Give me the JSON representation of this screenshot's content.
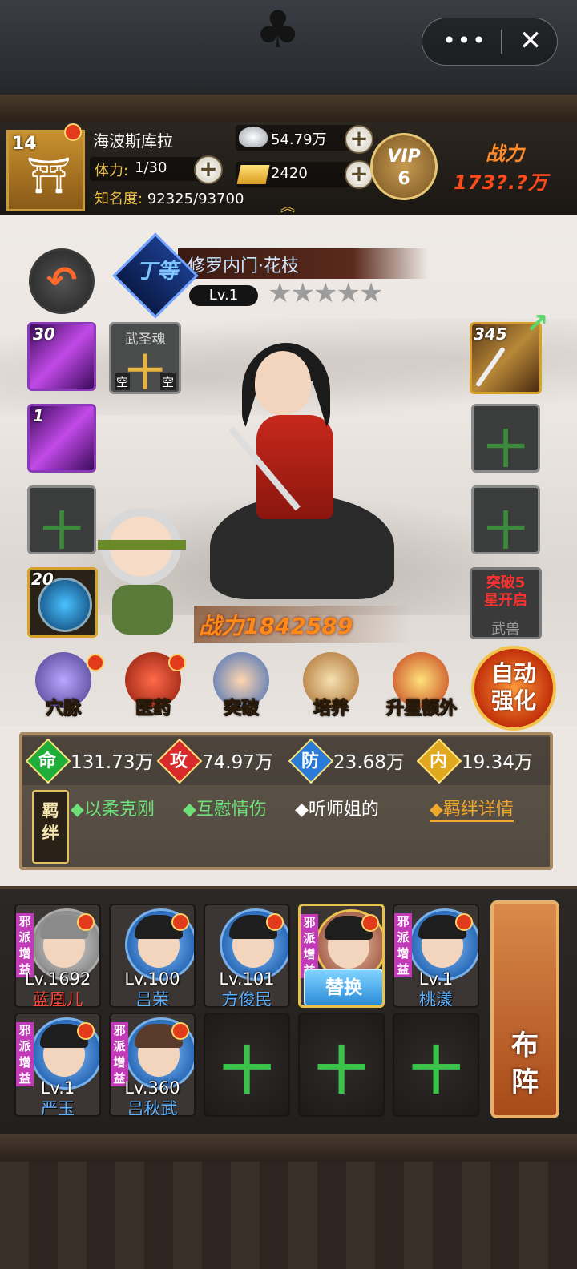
{
  "topbar": {
    "more_icon": "•••",
    "close_icon": "✕"
  },
  "player": {
    "level": "14",
    "name": "海波斯库拉",
    "stamina_label": "体力:",
    "stamina_value": "1/30",
    "fame_label": "知名度:",
    "fame_value": "92325/93700",
    "silver": "54.79万",
    "gold": "2420",
    "vip_label": "VIP",
    "vip_level": "6",
    "power_label": "战力",
    "power_value": "173?.?万"
  },
  "hero": {
    "grade": "丁等",
    "title": "修罗内门·花枝",
    "level": "Lv.1",
    "stars_total": 5,
    "stars_filled": 0,
    "stars": "★★★★★",
    "combat_power": "战力1842589"
  },
  "slots": {
    "skill1_level": "30",
    "skill2_level": "1",
    "soul_title": "武圣魂",
    "soul_plus": "十",
    "soul_empty_a": "空",
    "soul_empty_b": "空",
    "plus": "十",
    "weapon_level": "345",
    "orb_level": "20",
    "beast_lock": "突破5星开启",
    "beast_label": "武兽"
  },
  "actions": [
    {
      "label": "穴脉",
      "icon": "meridian-icon"
    },
    {
      "label": "医药",
      "icon": "medicine-icon"
    },
    {
      "label": "突破",
      "icon": "breakthrough-icon"
    },
    {
      "label": "培养",
      "icon": "cultivate-icon"
    },
    {
      "label": "升星额外",
      "icon": "star-up-icon"
    }
  ],
  "auto_strengthen": "自动强化",
  "stats": [
    {
      "icon_text": "命",
      "value": "131.73万",
      "color": "#1fae3a"
    },
    {
      "icon_text": "攻",
      "value": "74.97万",
      "color": "#d82a2a"
    },
    {
      "icon_text": "防",
      "value": "23.68万",
      "color": "#2a7ad8"
    },
    {
      "icon_text": "内",
      "value": "19.34万",
      "color": "#e0a81e"
    }
  ],
  "bonds": {
    "label": "羁绊",
    "items": [
      "◆以柔克刚",
      "◆互慰情伤",
      "◆听师姐的"
    ],
    "detail": "◆羁绊详情"
  },
  "roster": {
    "faction_tag": "邪派增益",
    "swap_label": "替换",
    "plus": "十",
    "members": [
      {
        "level": "Lv.1692",
        "name": "蓝凰儿",
        "name_color": "red",
        "tag": true
      },
      {
        "level": "Lv.100",
        "name": "吕荣",
        "name_color": "blue",
        "tag": false
      },
      {
        "level": "Lv.101",
        "name": "方俊民",
        "name_color": "blue",
        "tag": false
      },
      {
        "level": "",
        "name": "",
        "name_color": "",
        "tag": true,
        "selected": true
      },
      {
        "level": "Lv.1",
        "name": "桃漾",
        "name_color": "blue",
        "tag": true
      },
      {
        "level": "Lv.1",
        "name": "严玉",
        "name_color": "blue",
        "tag": true
      },
      {
        "level": "Lv.360",
        "name": "吕秋武",
        "name_color": "blue",
        "tag": true
      }
    ],
    "formation_label": "布阵"
  }
}
